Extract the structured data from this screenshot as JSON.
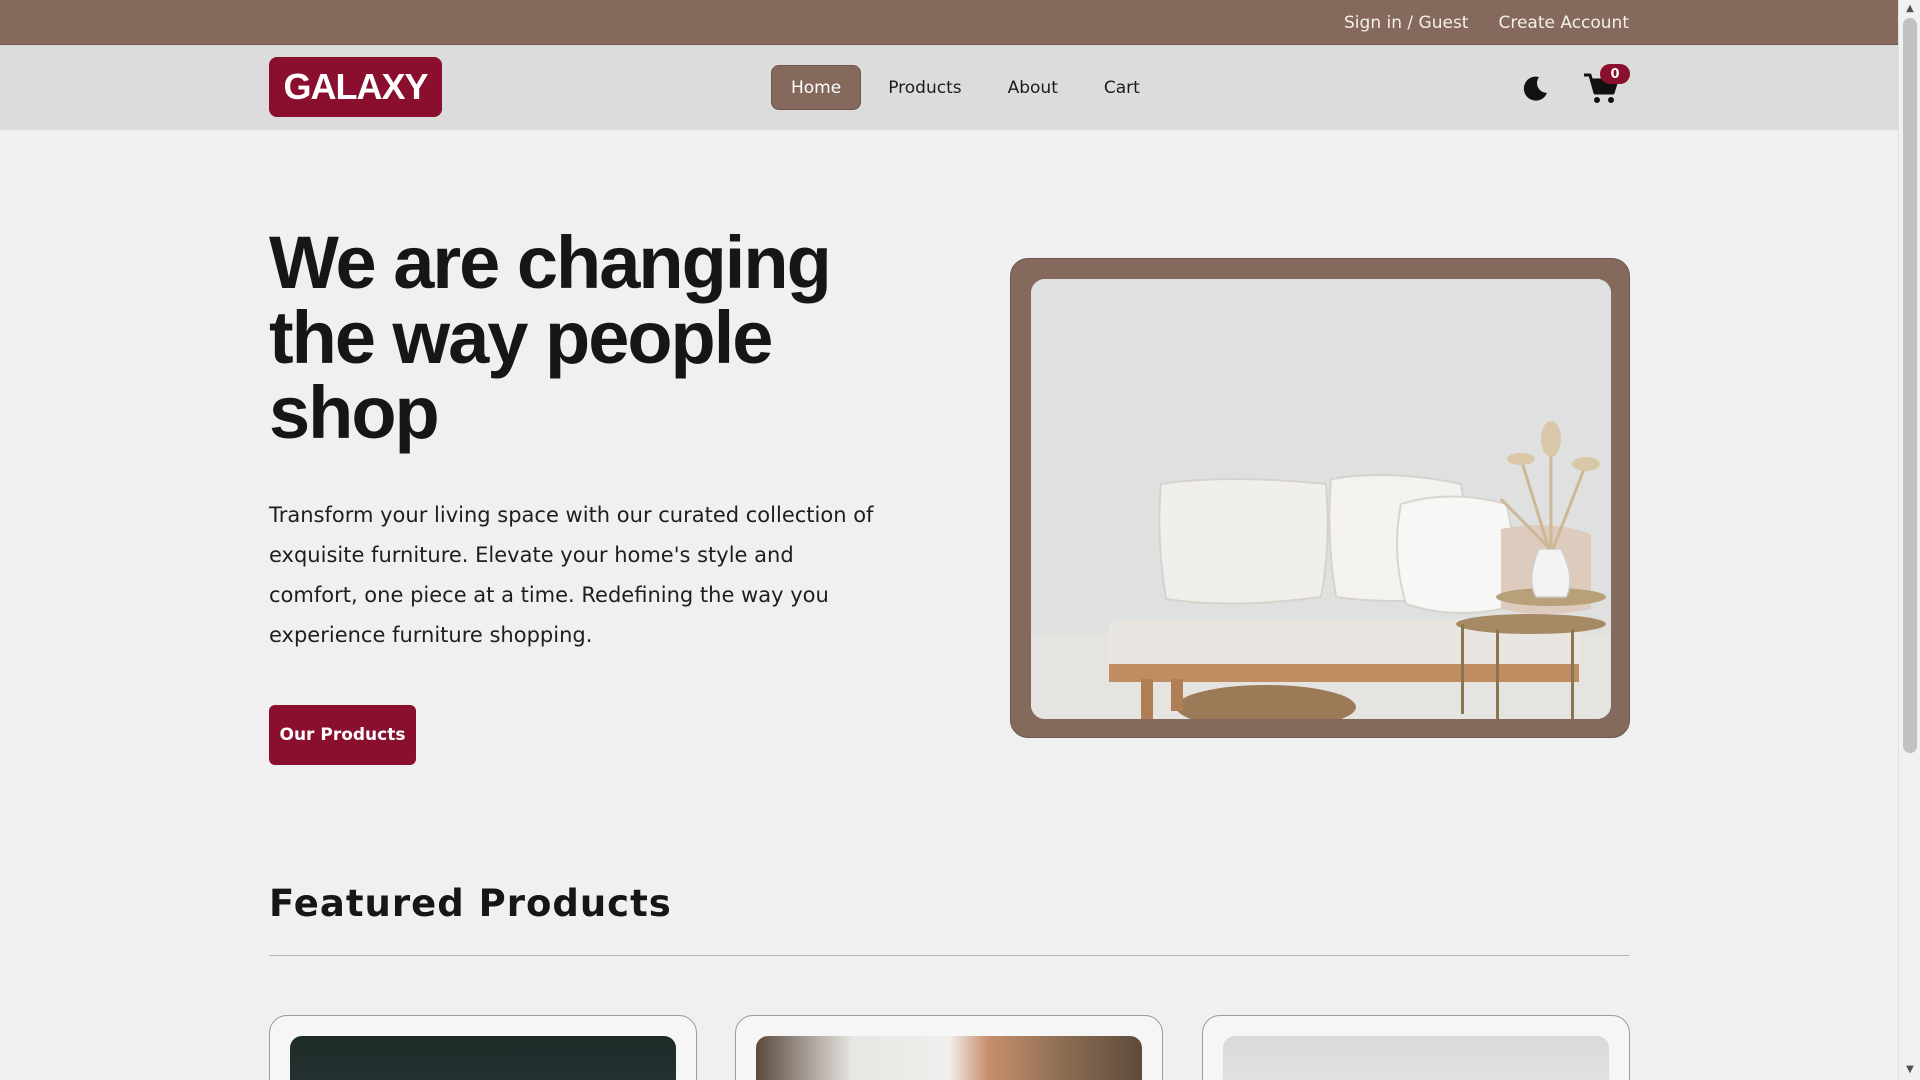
{
  "topbar": {
    "signin_label": "Sign in / Guest",
    "create_account_label": "Create Account"
  },
  "navbar": {
    "logo": "GALAXY",
    "links": [
      {
        "label": "Home",
        "active": true
      },
      {
        "label": "Products",
        "active": false
      },
      {
        "label": "About",
        "active": false
      },
      {
        "label": "Cart",
        "active": false
      }
    ],
    "theme_icon": "moon-icon",
    "cart_icon": "cart-icon",
    "cart_count": "0"
  },
  "hero": {
    "title": "We are changing the way people shop",
    "text": "Transform your living space with our curated collection of exquisite furniture. Elevate your home's style and comfort, one piece at a time. Redefining the way you experience furniture shopping.",
    "cta_label": "Our Products"
  },
  "featured": {
    "title": "Featured Products"
  },
  "colors": {
    "brand": "#8a0f2e",
    "accent": "#84695c",
    "background": "#f0f0f0"
  }
}
